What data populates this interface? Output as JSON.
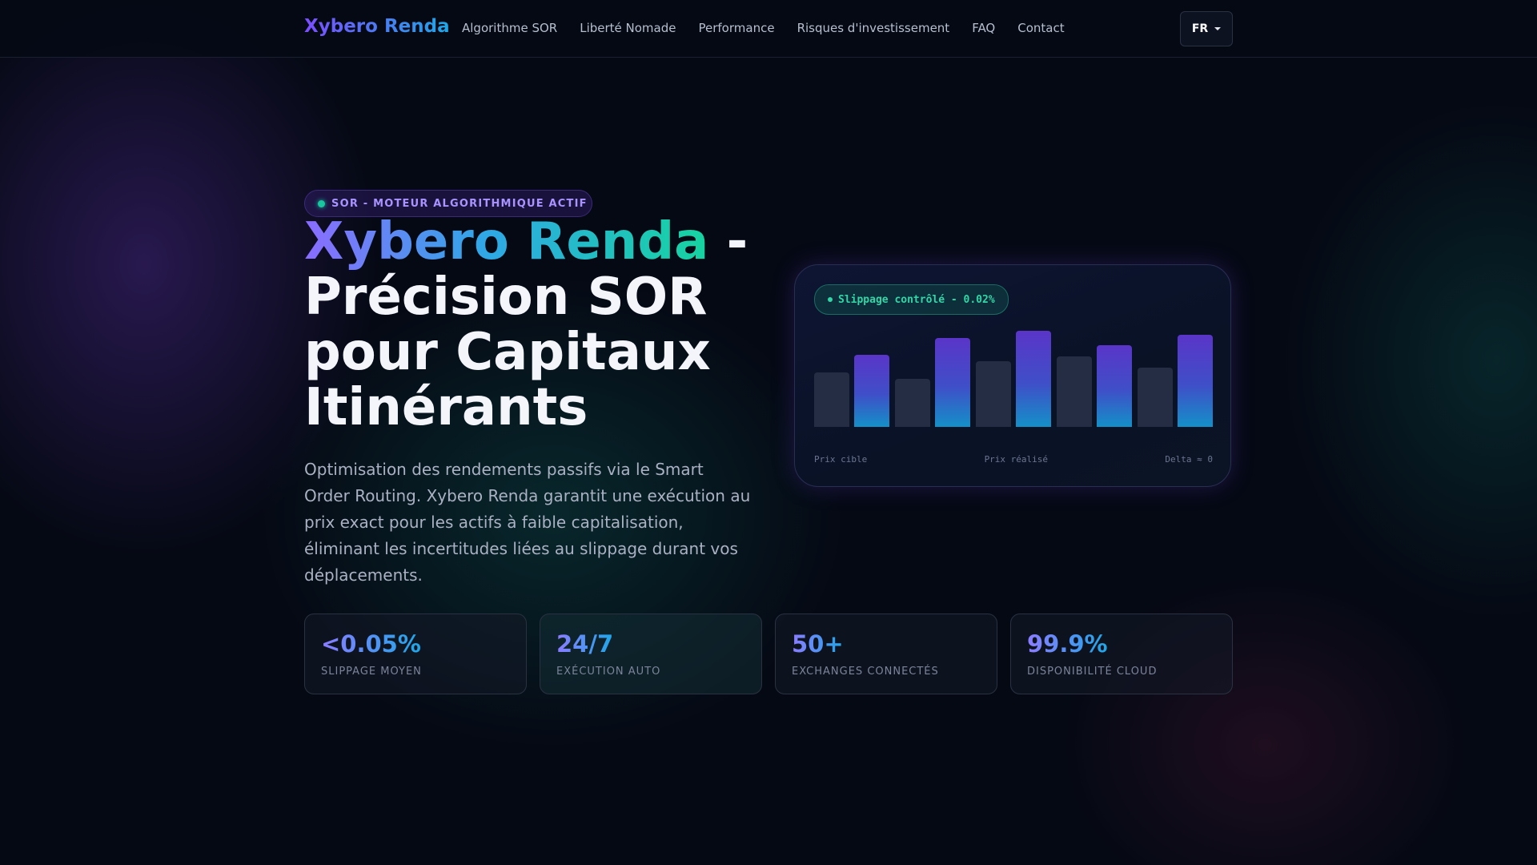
{
  "nav": {
    "brand": "Xybero Renda",
    "links": [
      "Algorithme SOR",
      "Liberté Nomade",
      "Performance",
      "Risques d'investissement",
      "FAQ",
      "Contact"
    ],
    "language": "FR"
  },
  "hero": {
    "badge": "SOR - MOTEUR ALGORITHMIQUE ACTIF",
    "title_highlight": "Xybero Renda",
    "title_rest": " - Précision SOR pour Capitaux Itinérants",
    "description": "Optimisation des rendements passifs via le Smart Order Routing. Xybero Renda garantit une exécution au prix exact pour les actifs à faible capitalisation, éliminant les incertitudes liées au slippage durant vos déplacements."
  },
  "card": {
    "status": "Slippage contrôlé - 0.02%",
    "label_left": "Prix cible",
    "label_center": "Prix réalisé",
    "label_right": "Delta ≈ 0",
    "bars": [
      {
        "level": 0.56,
        "style": "muted"
      },
      {
        "level": 0.74,
        "style": "accent"
      },
      {
        "level": 0.49,
        "style": "muted"
      },
      {
        "level": 0.91,
        "style": "accent"
      },
      {
        "level": 0.67,
        "style": "muted"
      },
      {
        "level": 0.98,
        "style": "accent"
      },
      {
        "level": 0.72,
        "style": "muted"
      },
      {
        "level": 0.84,
        "style": "accent"
      },
      {
        "level": 0.61,
        "style": "muted"
      },
      {
        "level": 0.94,
        "style": "accent"
      }
    ]
  },
  "stats": [
    {
      "value": "<0.05%",
      "label": "SLIPPAGE MOYEN"
    },
    {
      "value": "24/7",
      "label": "EXÉCUTION AUTO"
    },
    {
      "value": "50+",
      "label": "EXCHANGES CONNECTÉS"
    },
    {
      "value": "99.9%",
      "label": "DISPONIBILITÉ CLOUD"
    }
  ],
  "colors": {
    "background": "#050914",
    "accent_purple": "#7c4dff",
    "accent_blue": "#1ea7e8",
    "accent_green": "#16d4a0"
  }
}
